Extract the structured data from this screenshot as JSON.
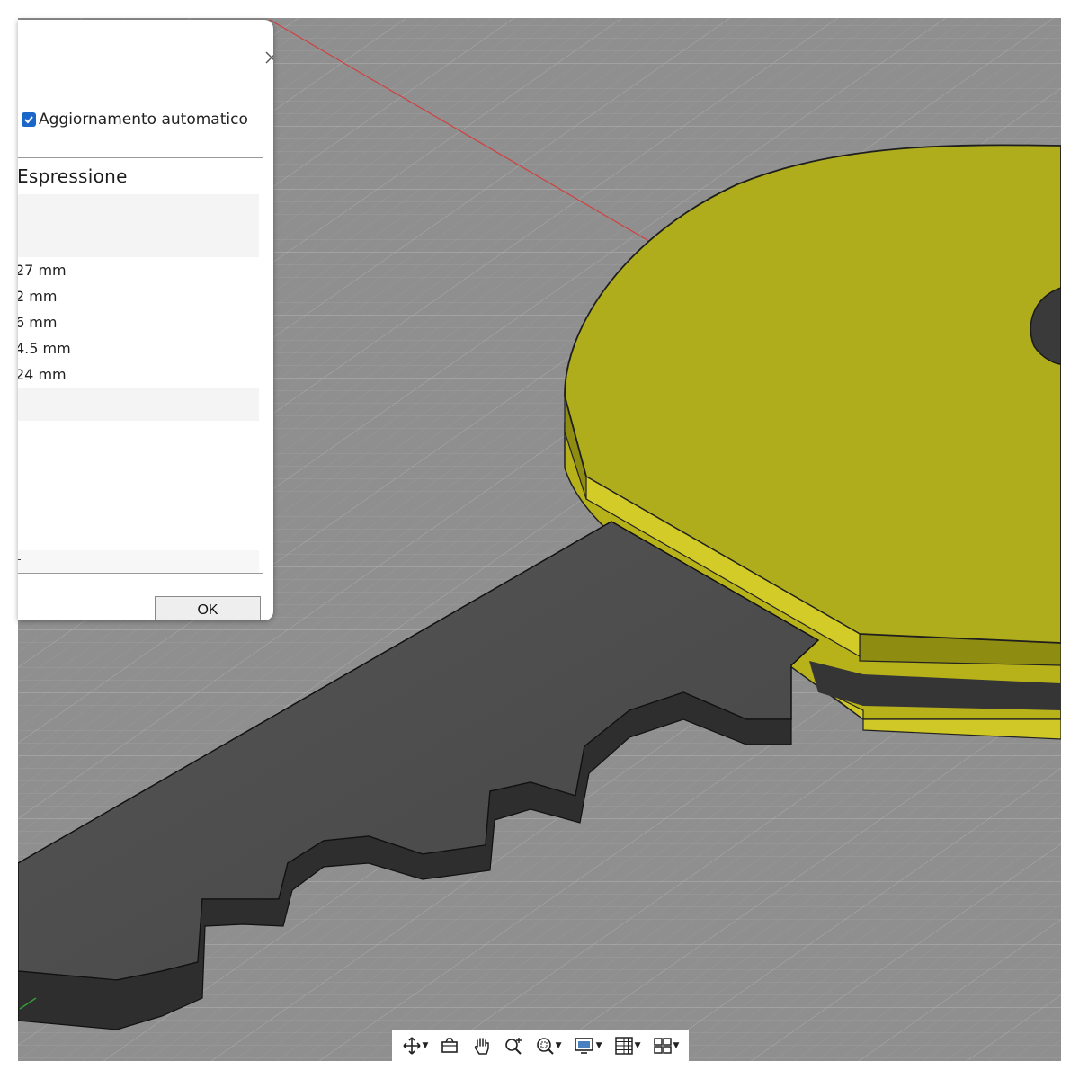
{
  "dialog": {
    "auto_update_label": "Aggiornamento automatico",
    "auto_update_checked": true,
    "column_header": "Espressione",
    "rows": [
      "27 mm",
      "2 mm",
      "6 mm",
      "4.5 mm",
      "24 mm"
    ],
    "ok_label": "OK",
    "accent_color": "#1a66c9"
  },
  "viewport": {
    "background_color": "#8f8f8f",
    "model_colors": {
      "key_head": "#afac1c",
      "key_blade": "#4c4c4c"
    }
  },
  "navbar": {
    "items": [
      {
        "icon": "orbit-icon",
        "has_dropdown": true
      },
      {
        "icon": "look-at-icon",
        "has_dropdown": false
      },
      {
        "icon": "pan-hand-icon",
        "has_dropdown": false
      },
      {
        "icon": "zoom-icon",
        "has_dropdown": false
      },
      {
        "icon": "fit-window-icon",
        "has_dropdown": true
      },
      {
        "icon": "display-settings-icon",
        "has_dropdown": true
      },
      {
        "icon": "grid-icon",
        "has_dropdown": true
      },
      {
        "icon": "viewports-icon",
        "has_dropdown": true
      }
    ]
  }
}
